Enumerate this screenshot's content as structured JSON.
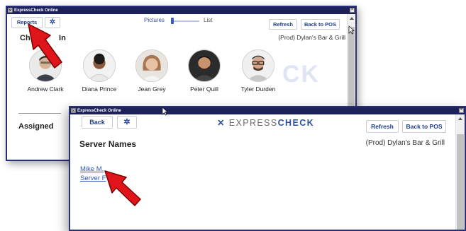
{
  "win1": {
    "title": "ExpressCheck Online",
    "close": "×",
    "reports_label": "Reports",
    "gear": "✲",
    "view_toggle": {
      "left": "Pictures",
      "right": "List"
    },
    "refresh_label": "Refresh",
    "back_pos_label": "Back to POS",
    "section_title_a": "Check",
    "section_title_b": "In",
    "location": "(Prod) Dylan's Bar & Grill",
    "watermark": "CK",
    "people": [
      {
        "name": "Andrew Clark"
      },
      {
        "name": "Diana Prince"
      },
      {
        "name": "Jean Grey"
      },
      {
        "name": "Peter Quill"
      },
      {
        "name": "Tyler Durden"
      }
    ],
    "assigned_label": "Assigned"
  },
  "win2": {
    "title": "ExpressCheck Online",
    "close": "×",
    "back_label": "Back",
    "gear": "✲",
    "logo_x": "✕",
    "logo_express": "EXPRESS",
    "logo_check": "CHECK",
    "refresh_label": "Refresh",
    "back_pos_label": "Back to POS",
    "heading": "Server Names",
    "location": "(Prod) Dylan's Bar & Grill",
    "servers": [
      "Mike M.",
      "Server F"
    ]
  },
  "colors": {
    "titlebar": "#1d2159",
    "button_text": "#1f3d8a",
    "link": "#2a55b8",
    "logo_express": "#6b6b6b",
    "logo_check": "#2d4fa3",
    "annotation_arrow": "#e0141b"
  }
}
